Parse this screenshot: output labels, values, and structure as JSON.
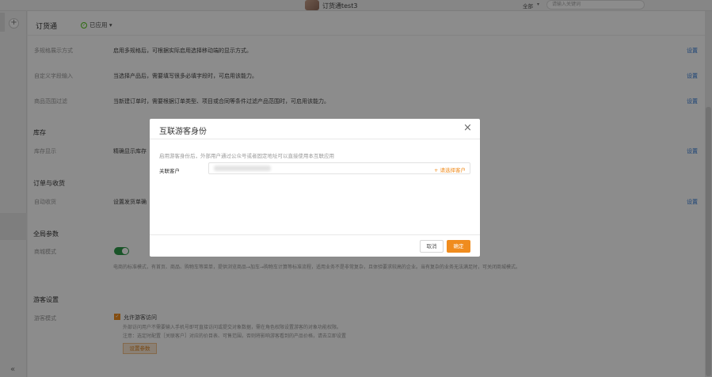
{
  "topbar": {
    "store_name": "订货通test3",
    "scope": "全部",
    "search_placeholder": "请输入关键词"
  },
  "rail": {
    "plus": "+",
    "collapse": "«"
  },
  "header": {
    "title": "订货通",
    "status": "已应用"
  },
  "rows": [
    {
      "label": "多规格展示方式",
      "desc": "启用多规格后，可根据实际启用选择移动端的显示方式。",
      "link": "设置"
    },
    {
      "label": "自定义字段输入",
      "desc": "当选择产品后，需要填写很多必填字段时，可启用该能力。",
      "link": "设置"
    },
    {
      "label": "商品范围过滤",
      "desc": "当新建订单时，需要根据订单类型、项目或合同等条件过滤产品范围时，可启用该能力。",
      "link": "设置"
    }
  ],
  "stock": {
    "title": "库存",
    "label": "库存显示",
    "desc": "精确显示库存",
    "link": "设置"
  },
  "order": {
    "title": "订单与收货",
    "label": "自动收货",
    "desc": "设置发货单确",
    "link": "设置"
  },
  "global": {
    "title": "全局参数",
    "label": "商城模式",
    "toggle_on": true,
    "note": "电商的标准模式，有首页、商品、购物车等菜单，提供浏览商品→加车→购物车计算等标准流程，适用业务不是非常复杂，且体验要求较高的企业。当有复杂的业务无法满足时，可关闭商城模式。"
  },
  "guest": {
    "title": "游客设置",
    "label": "游客模式",
    "checkbox_label": "允许游客访问",
    "checked": true,
    "note1": "外部访问用户不需要输入手机号即可直接访问或提交对象数据，需在角色权限设置游客的对象功能权限。",
    "note2": "注意：选定时配置［关联客户］对应的价目表、可售范围，否则将影响游客看到的产品价格，请去立即设置",
    "button": "设置参数"
  },
  "modal": {
    "title": "互联游客身份",
    "close": "×",
    "hint": "启用游客身份后，外部用户通过公众号或者固定地址可以直接使用本互联应用",
    "field_label": "关联客户",
    "choose": "+ 请选择客户",
    "cancel": "取消",
    "ok": "确定"
  }
}
